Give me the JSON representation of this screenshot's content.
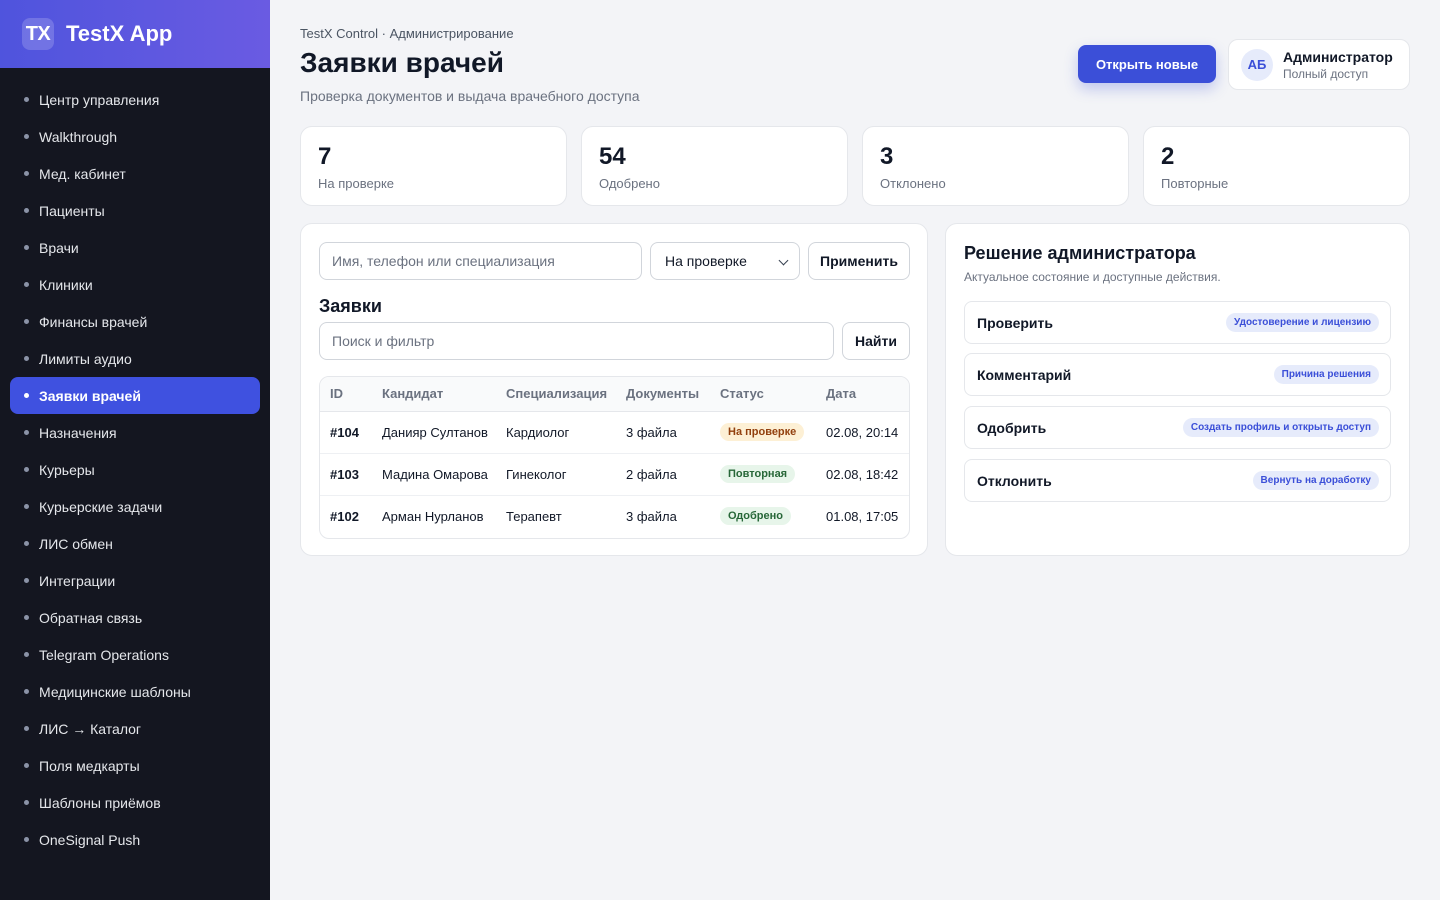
{
  "brand": {
    "logo": "TX",
    "name": "TestX App"
  },
  "sidebar": {
    "items": [
      {
        "label": "Центр управления"
      },
      {
        "label": "Walkthrough"
      },
      {
        "label": "Мед. кабинет"
      },
      {
        "label": "Пациенты"
      },
      {
        "label": "Врачи"
      },
      {
        "label": "Клиники"
      },
      {
        "label": "Финансы врачей"
      },
      {
        "label": "Лимиты аудио"
      },
      {
        "label": "Заявки врачей",
        "active": true
      },
      {
        "label": "Назначения"
      },
      {
        "label": "Курьеры"
      },
      {
        "label": "Курьерские задачи"
      },
      {
        "label": "ЛИС обмен"
      },
      {
        "label": "Интеграции"
      },
      {
        "label": "Обратная связь"
      },
      {
        "label": "Telegram Operations"
      },
      {
        "label": "Медицинские шаблоны"
      },
      {
        "label": "ЛИС → Каталог"
      },
      {
        "label": "Поля медкарты"
      },
      {
        "label": "Шаблоны приёмов"
      },
      {
        "label": "OneSignal Push"
      }
    ]
  },
  "header": {
    "breadcrumb": "TestX Control · Администрирование",
    "title": "Заявки врачей",
    "subtitle": "Проверка документов и выдача врачебного доступа",
    "primary_button": "Открыть новые",
    "user": {
      "initials": "АБ",
      "name": "Администратор",
      "role": "Полный доступ"
    }
  },
  "stats": [
    {
      "value": "7",
      "label": "На проверке"
    },
    {
      "value": "54",
      "label": "Одобрено"
    },
    {
      "value": "3",
      "label": "Отклонено"
    },
    {
      "value": "2",
      "label": "Повторные"
    }
  ],
  "filters": {
    "query_placeholder": "Имя, телефон или специализация",
    "status_selected": "На проверке",
    "apply_label": "Применить"
  },
  "applications": {
    "title": "Заявки",
    "search_placeholder": "Поиск и фильтр",
    "search_button": "Найти",
    "columns": [
      "ID",
      "Кандидат",
      "Специализация",
      "Документы",
      "Статус",
      "Дата"
    ],
    "rows": [
      {
        "id": "#104",
        "candidate": "Данияр Султанов",
        "specialization": "Кардиолог",
        "documents": "3 файла",
        "status": "На проверке",
        "status_kind": "review",
        "date": "02.08, 20:14"
      },
      {
        "id": "#103",
        "candidate": "Мадина Омарова",
        "specialization": "Гинеколог",
        "documents": "2 файла",
        "status": "Повторная",
        "status_kind": "repeat",
        "date": "02.08, 18:42"
      },
      {
        "id": "#102",
        "candidate": "Арман Нурланов",
        "specialization": "Терапевт",
        "documents": "3 файла",
        "status": "Одобрено",
        "status_kind": "approved",
        "date": "01.08, 17:05"
      }
    ]
  },
  "decision": {
    "title": "Решение администратора",
    "subtitle": "Актуальное состояние и доступные действия.",
    "actions": [
      {
        "label": "Проверить",
        "tag": "Удостоверение и лицензию"
      },
      {
        "label": "Комментарий",
        "tag": "Причина решения"
      },
      {
        "label": "Одобрить",
        "tag": "Создать профиль и открыть доступ"
      },
      {
        "label": "Отклонить",
        "tag": "Вернуть на доработку"
      }
    ]
  },
  "colors": {
    "accent": "#3b4fd8",
    "sidebar_bg": "#141620",
    "brand_gradient_start": "#4f54dd",
    "brand_gradient_end": "#6a5be2",
    "review_badge": "#fdf0d5",
    "success_badge": "#e7f5ea"
  }
}
